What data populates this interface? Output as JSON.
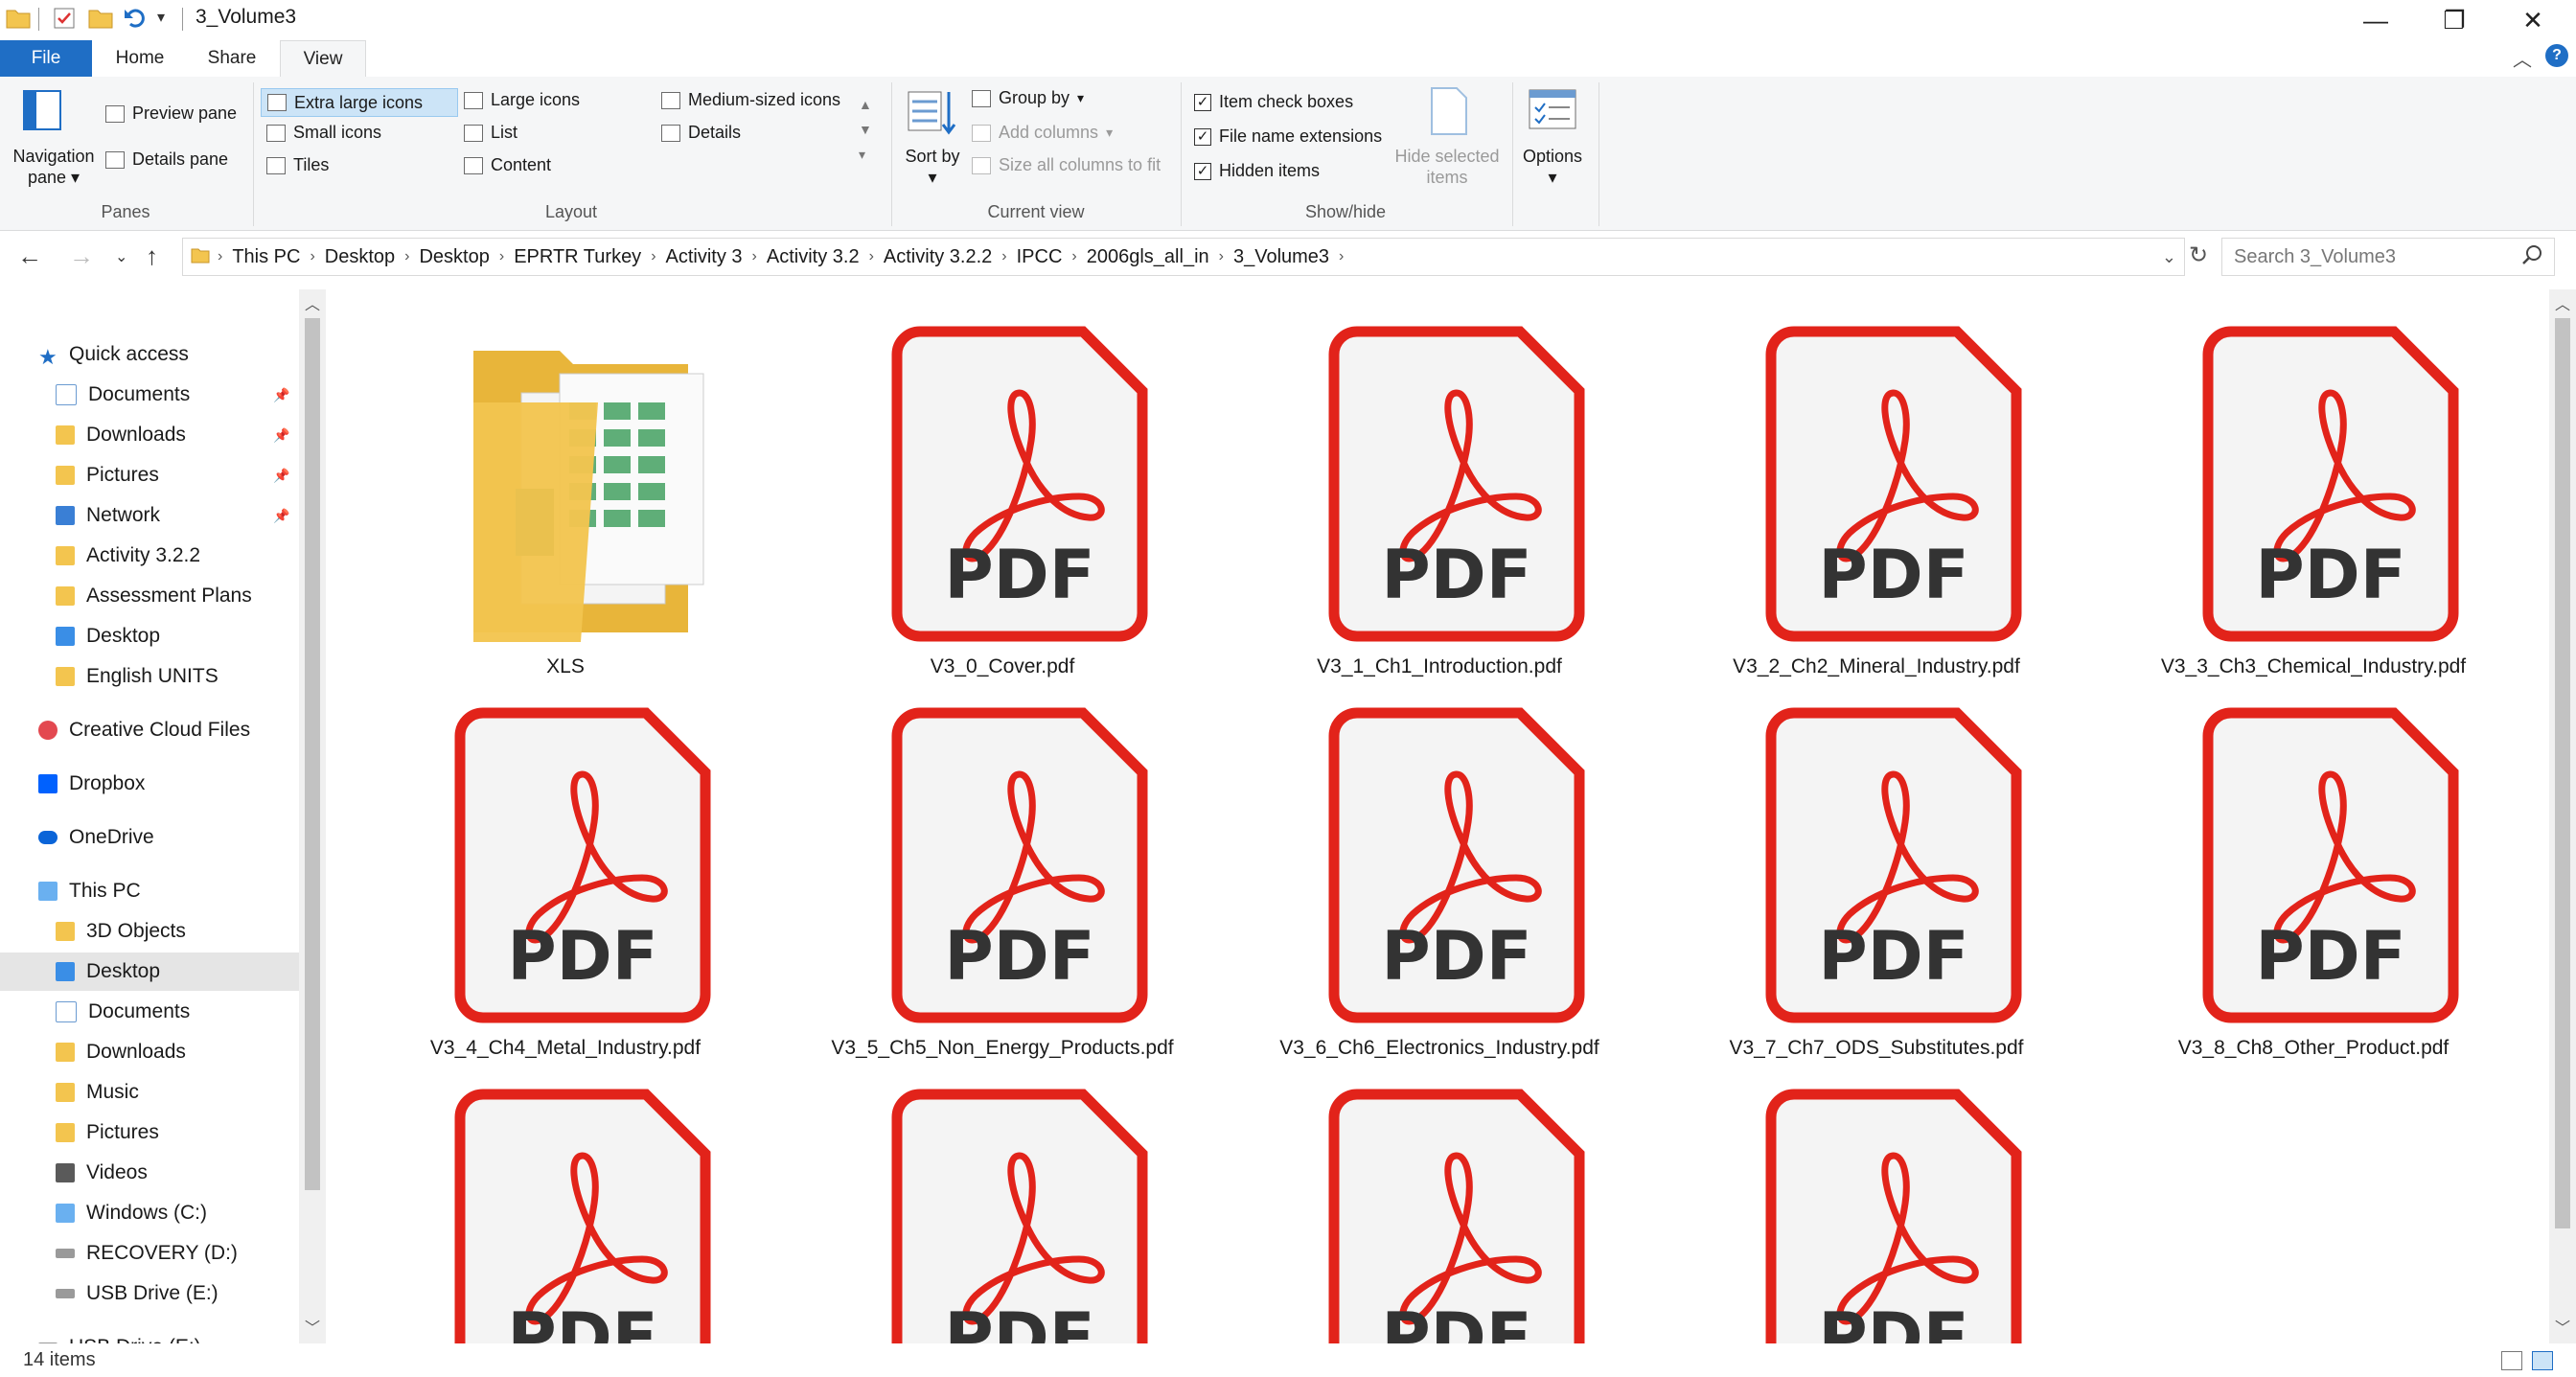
{
  "window": {
    "title": "3_Volume3"
  },
  "tabs": [
    "File",
    "Home",
    "Share",
    "View"
  ],
  "ribbon": {
    "panes": {
      "group_label": "Panes",
      "navigation_pane": "Navigation pane",
      "preview_pane": "Preview pane",
      "details_pane": "Details pane"
    },
    "layout": {
      "group_label": "Layout",
      "options": [
        "Extra large icons",
        "Large icons",
        "Medium-sized icons",
        "Small icons",
        "List",
        "Details",
        "Tiles",
        "Content"
      ],
      "selected": "Extra large icons"
    },
    "current_view": {
      "group_label": "Current view",
      "sort_by": "Sort by",
      "group_by": "Group by",
      "add_columns": "Add columns",
      "size_columns": "Size all columns to fit"
    },
    "show_hide": {
      "group_label": "Show/hide",
      "item_check_boxes": "Item check boxes",
      "file_name_extensions": "File name extensions",
      "hidden_items": "Hidden items",
      "hide_selected_items": "Hide selected items"
    },
    "options": "Options"
  },
  "address": {
    "crumbs": [
      "This PC",
      "Desktop",
      "Desktop",
      "EPRTR Turkey",
      "Activity 3",
      "Activity 3.2",
      "Activity 3.2.2",
      "IPCC",
      "2006gls_all_in",
      "3_Volume3"
    ],
    "search_placeholder": "Search 3_Volume3"
  },
  "sidebar": {
    "quick_access": "Quick access",
    "quick_items": [
      "Documents",
      "Downloads",
      "Pictures",
      "Network",
      "Activity 3.2.2",
      "Assessment Plans",
      "Desktop",
      "English UNITS"
    ],
    "creative_cloud": "Creative Cloud Files",
    "dropbox": "Dropbox",
    "onedrive": "OneDrive",
    "this_pc": "This PC",
    "pc_items": [
      "3D Objects",
      "Desktop",
      "Documents",
      "Downloads",
      "Music",
      "Pictures",
      "Videos",
      "Windows (C:)",
      "RECOVERY (D:)",
      "USB Drive (E:)"
    ],
    "usb_root": "USB Drive (E:)"
  },
  "files": [
    {
      "name": "XLS",
      "type": "folder"
    },
    {
      "name": "V3_0_Cover.pdf",
      "type": "pdf"
    },
    {
      "name": "V3_1_Ch1_Introduction.pdf",
      "type": "pdf"
    },
    {
      "name": "V3_2_Ch2_Mineral_Industry.pdf",
      "type": "pdf"
    },
    {
      "name": "V3_3_Ch3_Chemical_Industry.pdf",
      "type": "pdf"
    },
    {
      "name": "V3_4_Ch4_Metal_Industry.pdf",
      "type": "pdf"
    },
    {
      "name": "V3_5_Ch5_Non_Energy_Products.pdf",
      "type": "pdf"
    },
    {
      "name": "V3_6_Ch6_Electronics_Industry.pdf",
      "type": "pdf"
    },
    {
      "name": "V3_7_Ch7_ODS_Substitutes.pdf",
      "type": "pdf"
    },
    {
      "name": "V3_8_Ch8_Other_Product.pdf",
      "type": "pdf"
    },
    {
      "name": "",
      "type": "pdf"
    },
    {
      "name": "",
      "type": "pdf"
    },
    {
      "name": "",
      "type": "pdf"
    },
    {
      "name": "",
      "type": "pdf"
    }
  ],
  "pdf_text": "PDF",
  "status": {
    "item_count": "14 items"
  },
  "colors": {
    "accent": "#1f6ec5",
    "pdf_red": "#e2231a",
    "folder": "#f3c54f",
    "selection": "#cce4f7"
  }
}
